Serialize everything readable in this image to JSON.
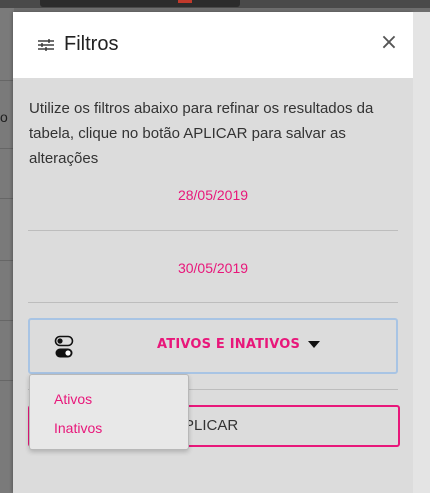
{
  "background": {
    "partial_text": "o"
  },
  "modal": {
    "title": "Filtros",
    "close_symbol": "×",
    "filter_icon": "filter-sliders-icon",
    "description": "Utilize os filtros abaixo para refinar os resultados da tabela, clique no botão APLICAR para salvar as alterações",
    "date_start": "28/05/2019",
    "date_end": "30/05/2019",
    "status_select": {
      "icon": "toggle-switch-icon",
      "selected": "ATIVOS E INATIVOS"
    },
    "dropdown_options": [
      "Ativos",
      "Inativos"
    ],
    "apply_label": "APLICAR",
    "apply_visible_text": "PLICAR"
  },
  "colors": {
    "accent": "#e8177a",
    "panel_bg": "#dcdcdc",
    "focus_border": "#a8c4e4"
  }
}
